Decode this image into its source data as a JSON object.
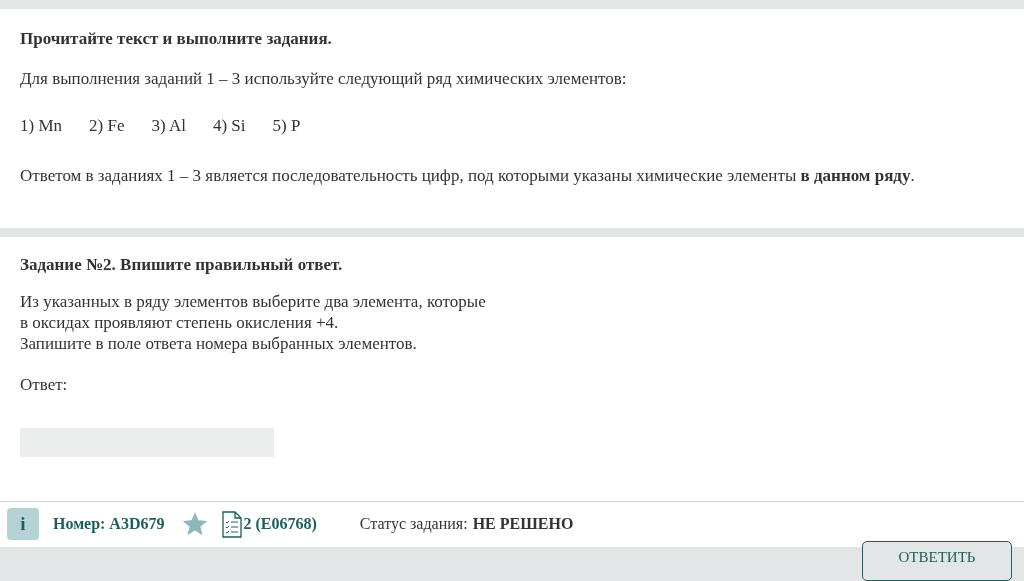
{
  "intro": {
    "title": "Прочитайте текст и выполните задания.",
    "text": "Для выполнения заданий 1 – 3 используйте следующий ряд химических элементов:",
    "elements": [
      "1) Mn",
      "2) Fe",
      "3) Al",
      "4) Si",
      "5) P"
    ],
    "note": "Ответом в заданиях 1 – 3 является последовательность цифр, под которыми указаны химические элементы  **в данном ряду**."
  },
  "task": {
    "title": "Задание №2. Впишите правильный ответ.",
    "lines": [
      "Из указанных в ряду элементов выберите два элемента, которые",
      "в оксидах проявляют степень окисления +4.",
      "Запишите в поле ответа номера выбранных элементов."
    ],
    "answer_label": "Ответ:"
  },
  "footer": {
    "info_button": "i",
    "number": "Номер: A3D679",
    "task_link": "2 (E06768)",
    "status_label": "Статус задания:",
    "status": "НЕ РЕШЕНО"
  },
  "submit_button": "ОТВЕТИТЬ"
}
